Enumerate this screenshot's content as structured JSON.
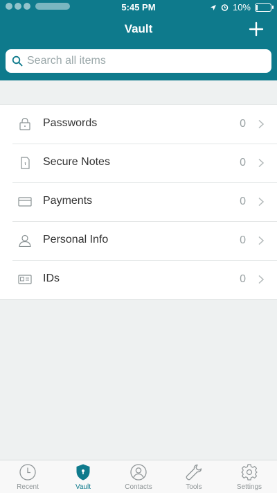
{
  "status_bar": {
    "time": "5:45 PM",
    "battery_percent": "10%",
    "battery_level": 0.1
  },
  "nav": {
    "title": "Vault",
    "add_icon": "plus-icon"
  },
  "search": {
    "placeholder": "Search all items",
    "value": ""
  },
  "categories": [
    {
      "label": "Passwords",
      "count": "0",
      "icon": "lock-icon"
    },
    {
      "label": "Secure Notes",
      "count": "0",
      "icon": "note-icon"
    },
    {
      "label": "Payments",
      "count": "0",
      "icon": "card-icon"
    },
    {
      "label": "Personal Info",
      "count": "0",
      "icon": "person-icon"
    },
    {
      "label": "IDs",
      "count": "0",
      "icon": "id-card-icon"
    }
  ],
  "tabs": [
    {
      "label": "Recent",
      "icon": "clock-icon",
      "active": false
    },
    {
      "label": "Vault",
      "icon": "shield-icon",
      "active": true
    },
    {
      "label": "Contacts",
      "icon": "contact-icon",
      "active": false
    },
    {
      "label": "Tools",
      "icon": "wrench-icon",
      "active": false
    },
    {
      "label": "Settings",
      "icon": "gear-icon",
      "active": false
    }
  ],
  "colors": {
    "brand": "#0e7a8c",
    "background": "#eef1f1",
    "tab_inactive": "#8f9597"
  }
}
